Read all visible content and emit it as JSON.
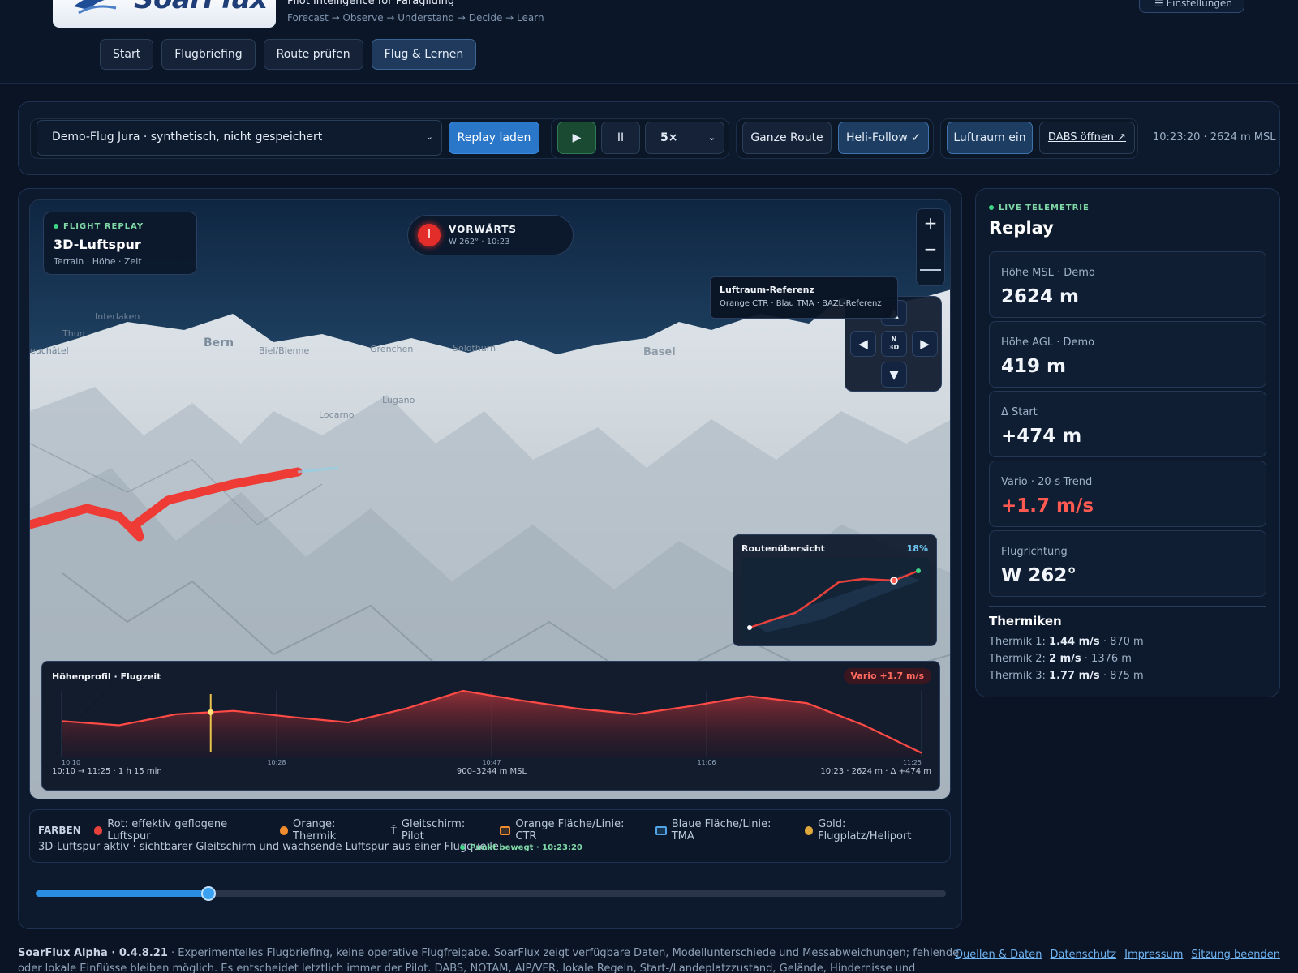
{
  "brand": {
    "name": "SoarFlux",
    "tagline": "Pilot Intelligence for Paragliding",
    "flow": "Forecast → Observe → Understand → Decide → Learn",
    "settings_label": "☰ Einstellungen"
  },
  "nav": {
    "items": [
      {
        "label": "Start"
      },
      {
        "label": "Flugbriefing"
      },
      {
        "label": "Route prüfen"
      },
      {
        "label": "Flug & Lernen"
      }
    ]
  },
  "toolbar": {
    "flight_select": "Demo-Flug Jura · synthetisch, nicht gespeichert",
    "replay_button": "Replay laden",
    "play_icon": "▶",
    "pause_icon": "II",
    "speed": "5×",
    "whole_route": "Ganze Route",
    "heli_follow": "Heli-Follow ✓",
    "airspace_toggle": "Luftraum ein",
    "dabs_link": "DABS öffnen ↗",
    "status": "10:23:20 · 2624 m MSL"
  },
  "map": {
    "card_eyebrow": "FLIGHT REPLAY",
    "card_title": "3D-Luftspur",
    "card_sub": "Terrain · Höhe · Zeit",
    "direction_title": "VORWÄRTS",
    "direction_sub": "W 262° · 10:23",
    "compass_label": "N",
    "compass_sub": "3D",
    "zoom_in": "+",
    "zoom_out": "−",
    "airspace_ref_title": "Luftraum-Referenz",
    "airspace_ref_sub": "Orange CTR · Blau TMA · BAZL-Referenz",
    "places": [
      {
        "name": "Interlaken"
      },
      {
        "name": "Thun"
      },
      {
        "name": "euchâtel"
      },
      {
        "name": "Bern"
      },
      {
        "name": "Biel/Bienne"
      },
      {
        "name": "Grenchen"
      },
      {
        "name": "Solothurn"
      },
      {
        "name": "Basel"
      },
      {
        "name": "Locarno"
      },
      {
        "name": "Lugano"
      }
    ]
  },
  "route_overview": {
    "title": "Routenübersicht",
    "percent": "18%",
    "progress": 0.18
  },
  "profile": {
    "title": "Höhenprofil · Flugzeit",
    "vario_badge": "Vario +1.7 m/s",
    "ticks": [
      "10:10",
      "10:28",
      "10:47",
      "11:06",
      "11:25"
    ],
    "range_time": "10:10 → 11:25 · 1 h 15 min",
    "range_alt": "900–3244 m MSL",
    "current": "10:23 · 2624 m · Δ +474 m"
  },
  "chart_data": {
    "type": "area",
    "title": "Höhenprofil · Flugzeit",
    "x_ticks": [
      "10:10",
      "10:28",
      "10:47",
      "11:06",
      "11:25"
    ],
    "x_minutes": [
      0,
      5,
      10,
      15,
      20,
      25,
      30,
      35,
      40,
      45,
      50,
      55,
      60,
      65,
      70,
      75
    ],
    "y_msl": [
      2150,
      2000,
      2400,
      2520,
      2300,
      2100,
      2600,
      3244,
      2900,
      2600,
      2400,
      2700,
      3050,
      2800,
      2000,
      1000
    ],
    "ylim": [
      900,
      3244
    ],
    "cursor_minutes": 13
  },
  "legend": {
    "title": "FARBEN",
    "items": [
      {
        "label": "Rot: effektiv geflogene Luftspur",
        "color": "#e8413c",
        "shape": "dot"
      },
      {
        "label": "Orange: Thermik",
        "color": "#f08c2e",
        "shape": "dot"
      },
      {
        "label": "Gleitschirm: Pilot",
        "color": "#c9d5e4",
        "shape": "glider"
      },
      {
        "label": "Orange Fläche/Linie: CTR",
        "color": "#f08c2e",
        "shape": "square"
      },
      {
        "label": "Blaue Fläche/Linie: TMA",
        "color": "#4fa3e6",
        "shape": "square"
      },
      {
        "label": "Gold: Flugplatz/Heliport",
        "color": "#e0a83a",
        "shape": "dot"
      }
    ],
    "status_text": "3D-Luftspur aktiv · sichtbarer Gleitschirm und wachsende Luftspur aus einer Flugquelle.",
    "moved_label": "Punkt bewegt · 10:23:20"
  },
  "timeline": {
    "progress": 0.19
  },
  "telemetry": {
    "eyebrow": "LIVE TELEMETRIE",
    "title": "Replay",
    "cards": [
      {
        "label": "Höhe MSL · Demo",
        "value": "2624 m"
      },
      {
        "label": "Höhe AGL · Demo",
        "value": "419 m"
      },
      {
        "label": "Δ Start",
        "value": "+474 m"
      },
      {
        "label": "Vario · 20-s-Trend",
        "value": "+1.7 m/s"
      },
      {
        "label": "Flugrichtung",
        "value": "W 262°"
      }
    ],
    "thermals_title": "Thermiken",
    "thermals": [
      {
        "label": "Thermik 1:",
        "rate": "1.44 m/s",
        "alt": "· 870 m"
      },
      {
        "label": "Thermik 2:",
        "rate": "2 m/s",
        "alt": "· 1376 m"
      },
      {
        "label": "Thermik 3:",
        "rate": "1.77 m/s",
        "alt": "· 875 m"
      }
    ]
  },
  "footer": {
    "version": "SoarFlux Alpha · 0.4.8.21",
    "disclaimer": "· Experimentelles Flugbriefing, keine operative Flugfreigabe. SoarFlux zeigt verfügbare Daten, Modellunterschiede und Messabweichungen; fehlende oder lokale Einflüsse bleiben möglich. Es entscheidet letztlich immer der Pilot. DABS, NOTAM, AIP/VFR, lokale Regeln, Start-/Landeplatzzustand, Gelände, Hindernisse und Beobachtung vor Ort bleiben eigenständig zu prüfen. OSM: ©",
    "links": [
      "Quellen & Daten",
      "Datenschutz",
      "Impressum",
      "Sitzung beenden"
    ]
  },
  "colors": {
    "track": "#e8413c",
    "accent": "#2a76c8",
    "vario_positive": "#ff5a52",
    "status_green": "#3ed585"
  }
}
